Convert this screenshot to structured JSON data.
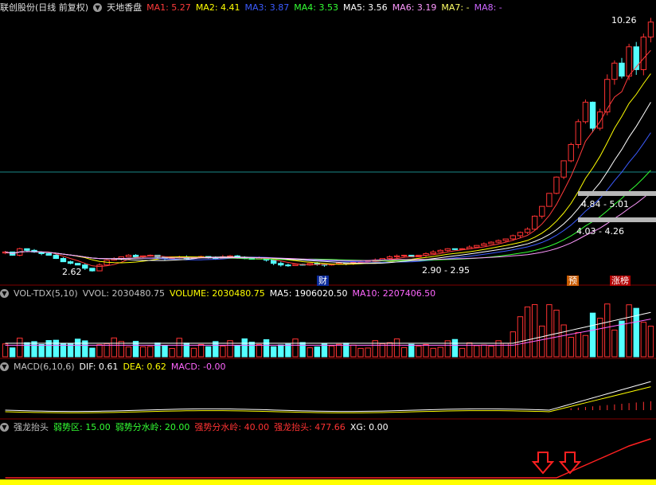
{
  "main": {
    "stock": "联创股份(日线 前复权)",
    "indicator": "天地香盘",
    "ma": [
      {
        "label": "MA1: 5.27",
        "color": "#ff3b3b"
      },
      {
        "label": "MA2: 4.41",
        "color": "#ffff00"
      },
      {
        "label": "MA3: 3.87",
        "color": "#3b5bff"
      },
      {
        "label": "MA4: 3.53",
        "color": "#33ff33"
      },
      {
        "label": "MA5: 3.56",
        "color": "#ffffff"
      },
      {
        "label": "MA6: 3.19",
        "color": "#ff99ff"
      },
      {
        "label": "MA7: -",
        "color": "#ffff66"
      },
      {
        "label": "MA8: -",
        "color": "#cc66ff"
      }
    ],
    "high_label": "10.26",
    "low_label": "2.62",
    "range_labels": [
      "4.84 - 5.01",
      "4.03 - 4.26",
      "2.90 - 2.95"
    ],
    "markers": [
      "财",
      "预",
      "涨榜"
    ]
  },
  "volume": {
    "title": "VOL-TDX(5,10)",
    "items": [
      {
        "label": "VVOL: 2030480.75",
        "color": "#c0c0c0"
      },
      {
        "label": "VOLUME: 2030480.75",
        "color": "#ffff00"
      },
      {
        "label": "MA5: 1906020.50",
        "color": "#ffffff"
      },
      {
        "label": "MA10: 2207406.50",
        "color": "#ff66ff"
      }
    ]
  },
  "macd": {
    "title": "MACD(6,10,6)",
    "items": [
      {
        "label": "DIF: 0.61",
        "color": "#ffffff"
      },
      {
        "label": "DEA: 0.62",
        "color": "#ffff00"
      },
      {
        "label": "MACD: -0.00",
        "color": "#ff66ff"
      }
    ]
  },
  "dragon": {
    "title": "强龙抬头",
    "items": [
      {
        "label": "弱势区: 15.00",
        "color": "#33ff33"
      },
      {
        "label": "弱势分水岭: 20.00",
        "color": "#33ff33"
      },
      {
        "label": "强势分水岭: 40.00",
        "color": "#ff3333"
      },
      {
        "label": "强龙抬头: 477.66",
        "color": "#ff3333"
      },
      {
        "label": "XG: 0.00",
        "color": "#ffffff"
      }
    ]
  },
  "chart_data": {
    "type": "candlestick",
    "close_series": [
      3.2,
      3.1,
      3.3,
      3.25,
      3.2,
      3.15,
      3.1,
      3.0,
      2.9,
      2.85,
      2.8,
      2.7,
      2.62,
      2.8,
      2.95,
      3.0,
      3.05,
      3.1,
      3.05,
      3.08,
      3.1,
      3.05,
      3.0,
      3.02,
      3.05,
      3.0,
      3.03,
      3.06,
      3.02,
      3.0,
      3.05,
      3.08,
      3.04,
      3.0,
      2.98,
      3.02,
      2.95,
      2.85,
      2.8,
      2.78,
      2.82,
      2.8,
      2.85,
      2.82,
      2.8,
      2.83,
      2.86,
      2.85,
      2.88,
      2.9,
      2.92,
      2.95,
      3.0,
      3.05,
      3.08,
      3.1,
      3.05,
      3.1,
      3.15,
      3.2,
      3.25,
      3.3,
      3.28,
      3.3,
      3.35,
      3.4,
      3.45,
      3.5,
      3.55,
      3.6,
      3.7,
      3.8,
      3.9,
      4.3,
      4.6,
      5.0,
      5.5,
      6.0,
      6.5,
      7.2,
      7.8,
      7.0,
      7.5,
      8.5,
      9.0,
      8.6,
      9.5,
      8.8,
      9.8,
      10.26
    ],
    "volume_ma5_last": 1906020.5,
    "volume_ma10_last": 2207406.5,
    "volume_last": 2030480.75
  }
}
